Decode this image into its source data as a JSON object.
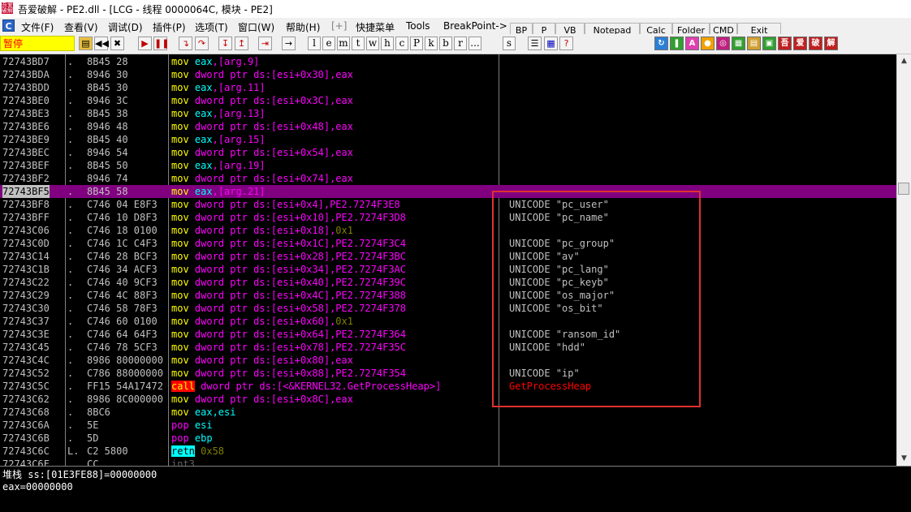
{
  "window": {
    "title": "吾爱破解 - PE2.dll - [LCG - 线程 0000064C, 模块 - PE2]",
    "logo": "吾爱破解"
  },
  "menu": [
    "文件(F)",
    "查看(V)",
    "调试(D)",
    "插件(P)",
    "选项(T)",
    "窗口(W)",
    "帮助(H)",
    "[+]",
    "快捷菜单",
    "Tools",
    "BreakPoint->"
  ],
  "plugin_buttons": [
    "BP",
    "P",
    "VB",
    "Notepad",
    "Calc",
    "Folder",
    "CMD",
    "Exit"
  ],
  "toolbar": {
    "status": "暂停",
    "letters": [
      "l",
      "e",
      "m",
      "t",
      "w",
      "h",
      "c",
      "P",
      "k",
      "b",
      "r",
      "...",
      "s"
    ],
    "cn_icons": [
      "吾",
      "爱",
      "破",
      "解"
    ]
  },
  "disasm_rows": [
    {
      "addr": "72743BD7",
      "mark": ".",
      "hex": "8B45 28",
      "asm": [
        [
          "m",
          "mov "
        ],
        [
          "o",
          "eax"
        ],
        [
          "p",
          ",[arg.9]"
        ]
      ],
      "cmt": ""
    },
    {
      "addr": "72743BDA",
      "mark": ".",
      "hex": "8946 30",
      "asm": [
        [
          "m",
          "mov "
        ],
        [
          "p",
          "dword ptr ds:[esi+0x30],eax"
        ]
      ],
      "cmt": ""
    },
    {
      "addr": "72743BDD",
      "mark": ".",
      "hex": "8B45 30",
      "asm": [
        [
          "m",
          "mov "
        ],
        [
          "o",
          "eax"
        ],
        [
          "p",
          ",[arg.11]"
        ]
      ],
      "cmt": ""
    },
    {
      "addr": "72743BE0",
      "mark": ".",
      "hex": "8946 3C",
      "asm": [
        [
          "m",
          "mov "
        ],
        [
          "p",
          "dword ptr ds:[esi+0x3C],eax"
        ]
      ],
      "cmt": ""
    },
    {
      "addr": "72743BE3",
      "mark": ".",
      "hex": "8B45 38",
      "asm": [
        [
          "m",
          "mov "
        ],
        [
          "o",
          "eax"
        ],
        [
          "p",
          ",[arg.13]"
        ]
      ],
      "cmt": ""
    },
    {
      "addr": "72743BE6",
      "mark": ".",
      "hex": "8946 48",
      "asm": [
        [
          "m",
          "mov "
        ],
        [
          "p",
          "dword ptr ds:[esi+0x48],eax"
        ]
      ],
      "cmt": ""
    },
    {
      "addr": "72743BE9",
      "mark": ".",
      "hex": "8B45 40",
      "asm": [
        [
          "m",
          "mov "
        ],
        [
          "o",
          "eax"
        ],
        [
          "p",
          ",[arg.15]"
        ]
      ],
      "cmt": ""
    },
    {
      "addr": "72743BEC",
      "mark": ".",
      "hex": "8946 54",
      "asm": [
        [
          "m",
          "mov "
        ],
        [
          "p",
          "dword ptr ds:[esi+0x54],eax"
        ]
      ],
      "cmt": ""
    },
    {
      "addr": "72743BEF",
      "mark": ".",
      "hex": "8B45 50",
      "asm": [
        [
          "m",
          "mov "
        ],
        [
          "o",
          "eax"
        ],
        [
          "p",
          ",[arg.19]"
        ]
      ],
      "cmt": ""
    },
    {
      "addr": "72743BF2",
      "mark": ".",
      "hex": "8946 74",
      "asm": [
        [
          "m",
          "mov "
        ],
        [
          "p",
          "dword ptr ds:[esi+0x74],eax"
        ]
      ],
      "cmt": ""
    },
    {
      "addr": "72743BF5",
      "mark": ".",
      "hex": "8B45 58",
      "asm": [
        [
          "m",
          "mov "
        ],
        [
          "o",
          "eax"
        ],
        [
          "p",
          ",[arg.21]"
        ]
      ],
      "cmt": "",
      "selected": true
    },
    {
      "addr": "72743BF8",
      "mark": ".",
      "hex": "C746 04 E8F3",
      "asm": [
        [
          "m",
          "mov "
        ],
        [
          "p",
          "dword ptr ds:[esi+0x4],PE2.7274F3E8"
        ]
      ],
      "cmt": "UNICODE \"pc_user\""
    },
    {
      "addr": "72743BFF",
      "mark": ".",
      "hex": "C746 10 D8F3",
      "asm": [
        [
          "m",
          "mov "
        ],
        [
          "p",
          "dword ptr ds:[esi+0x10],PE2.7274F3D8"
        ]
      ],
      "cmt": "UNICODE \"pc_name\""
    },
    {
      "addr": "72743C06",
      "mark": ".",
      "hex": "C746 18 0100",
      "asm": [
        [
          "m",
          "mov "
        ],
        [
          "p",
          "dword ptr ds:[esi+0x18],"
        ],
        [
          "n",
          "0x1"
        ]
      ],
      "cmt": ""
    },
    {
      "addr": "72743C0D",
      "mark": ".",
      "hex": "C746 1C C4F3",
      "asm": [
        [
          "m",
          "mov "
        ],
        [
          "p",
          "dword ptr ds:[esi+0x1C],PE2.7274F3C4"
        ]
      ],
      "cmt": "UNICODE \"pc_group\""
    },
    {
      "addr": "72743C14",
      "mark": ".",
      "hex": "C746 28 BCF3",
      "asm": [
        [
          "m",
          "mov "
        ],
        [
          "p",
          "dword ptr ds:[esi+0x28],PE2.7274F3BC"
        ]
      ],
      "cmt": "UNICODE \"av\""
    },
    {
      "addr": "72743C1B",
      "mark": ".",
      "hex": "C746 34 ACF3",
      "asm": [
        [
          "m",
          "mov "
        ],
        [
          "p",
          "dword ptr ds:[esi+0x34],PE2.7274F3AC"
        ]
      ],
      "cmt": "UNICODE \"pc_lang\""
    },
    {
      "addr": "72743C22",
      "mark": ".",
      "hex": "C746 40 9CF3",
      "asm": [
        [
          "m",
          "mov "
        ],
        [
          "p",
          "dword ptr ds:[esi+0x40],PE2.7274F39C"
        ]
      ],
      "cmt": "UNICODE \"pc_keyb\""
    },
    {
      "addr": "72743C29",
      "mark": ".",
      "hex": "C746 4C 88F3",
      "asm": [
        [
          "m",
          "mov "
        ],
        [
          "p",
          "dword ptr ds:[esi+0x4C],PE2.7274F388"
        ]
      ],
      "cmt": "UNICODE \"os_major\""
    },
    {
      "addr": "72743C30",
      "mark": ".",
      "hex": "C746 58 78F3",
      "asm": [
        [
          "m",
          "mov "
        ],
        [
          "p",
          "dword ptr ds:[esi+0x58],PE2.7274F378"
        ]
      ],
      "cmt": "UNICODE \"os_bit\""
    },
    {
      "addr": "72743C37",
      "mark": ".",
      "hex": "C746 60 0100",
      "asm": [
        [
          "m",
          "mov "
        ],
        [
          "p",
          "dword ptr ds:[esi+0x60],"
        ],
        [
          "n",
          "0x1"
        ]
      ],
      "cmt": ""
    },
    {
      "addr": "72743C3E",
      "mark": ".",
      "hex": "C746 64 64F3",
      "asm": [
        [
          "m",
          "mov "
        ],
        [
          "p",
          "dword ptr ds:[esi+0x64],PE2.7274F364"
        ]
      ],
      "cmt": "UNICODE \"ransom_id\""
    },
    {
      "addr": "72743C45",
      "mark": ".",
      "hex": "C746 78 5CF3",
      "asm": [
        [
          "m",
          "mov "
        ],
        [
          "p",
          "dword ptr ds:[esi+0x78],PE2.7274F35C"
        ]
      ],
      "cmt": "UNICODE \"hdd\""
    },
    {
      "addr": "72743C4C",
      "mark": ".",
      "hex": "8986 80000000",
      "asm": [
        [
          "m",
          "mov "
        ],
        [
          "p",
          "dword ptr ds:[esi+0x80],eax"
        ]
      ],
      "cmt": ""
    },
    {
      "addr": "72743C52",
      "mark": ".",
      "hex": "C786 88000000",
      "asm": [
        [
          "m",
          "mov "
        ],
        [
          "p",
          "dword ptr ds:[esi+0x88],PE2.7274F354"
        ]
      ],
      "cmt": "UNICODE \"ip\""
    },
    {
      "addr": "72743C5C",
      "mark": ".",
      "hex": "FF15 54A17472",
      "asm": [
        [
          "cl",
          "call"
        ],
        [
          "p",
          " dword ptr ds:[<&KERNEL32.GetProcessHeap>]"
        ]
      ],
      "cmt": "GetProcessHeap",
      "cmt_red": true
    },
    {
      "addr": "72743C62",
      "mark": ".",
      "hex": "8986 8C000000",
      "asm": [
        [
          "m",
          "mov "
        ],
        [
          "p",
          "dword ptr ds:[esi+0x8C],eax"
        ]
      ],
      "cmt": ""
    },
    {
      "addr": "72743C68",
      "mark": ".",
      "hex": "8BC6",
      "asm": [
        [
          "m",
          "mov "
        ],
        [
          "o",
          "eax,esi"
        ]
      ],
      "cmt": ""
    },
    {
      "addr": "72743C6A",
      "mark": ".",
      "hex": "5E",
      "asm": [
        [
          "p",
          "pop "
        ],
        [
          "o",
          "esi"
        ]
      ],
      "cmt": ""
    },
    {
      "addr": "72743C6B",
      "mark": ".",
      "hex": "5D",
      "asm": [
        [
          "p",
          "pop "
        ],
        [
          "o",
          "ebp"
        ]
      ],
      "cmt": ""
    },
    {
      "addr": "72743C6C",
      "mark": "L.",
      "hex": "C2 5800",
      "asm": [
        [
          "rt",
          "retn"
        ],
        [
          "n",
          " 0x58"
        ]
      ],
      "cmt": ""
    },
    {
      "addr": "72743C6F",
      "mark": "",
      "hex": "CC",
      "asm": [
        [
          "dim",
          "int3"
        ]
      ],
      "cmt": ""
    }
  ],
  "info": {
    "line1": "堆栈 ss:[01E3FE88]=00000000",
    "line2": "eax=00000000"
  },
  "colors": {
    "selection": "#800080",
    "highlight_box": "#e03030",
    "status_bg": "#ffff00"
  }
}
